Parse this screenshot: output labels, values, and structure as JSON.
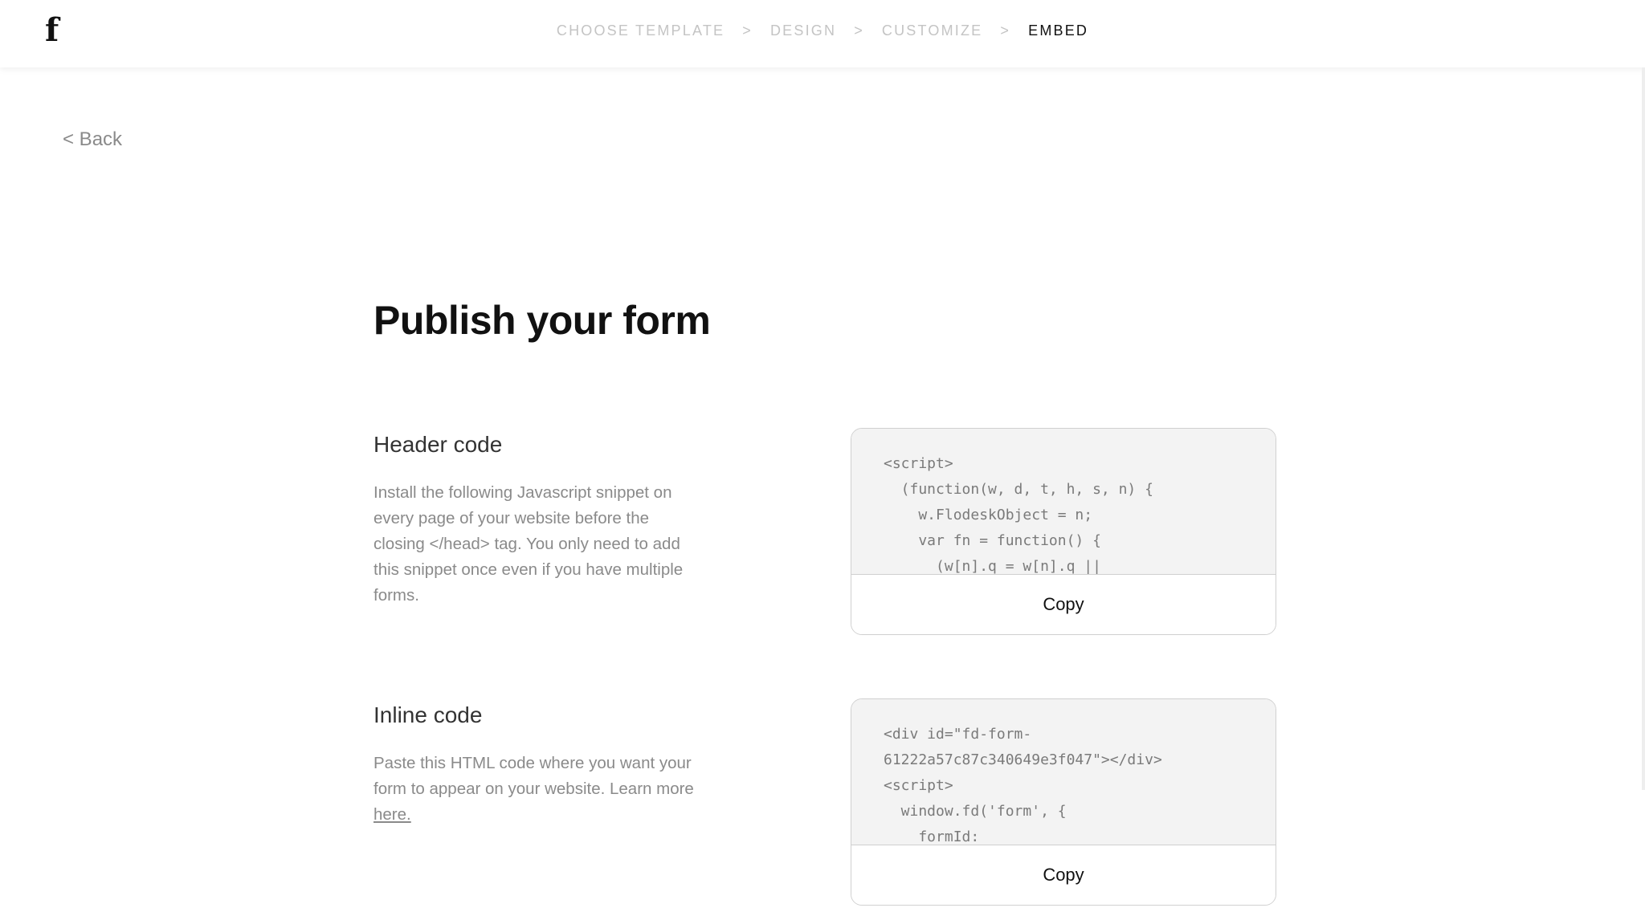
{
  "header": {
    "logo": "f",
    "steps": [
      {
        "label": "CHOOSE TEMPLATE",
        "active": false
      },
      {
        "label": "DESIGN",
        "active": false
      },
      {
        "label": "CUSTOMIZE",
        "active": false
      },
      {
        "label": "EMBED",
        "active": true
      }
    ],
    "separator": ">"
  },
  "back_label": "< Back",
  "page_title": "Publish your form",
  "sections": {
    "header_code": {
      "title": "Header code",
      "description": "Install the following Javascript snippet on every page of your website before the closing </head> tag. You only need to add this snippet once even if you have multiple forms.",
      "code": "<script>\n  (function(w, d, t, h, s, n) {\n    w.FlodeskObject = n;\n    var fn = function() {\n      (w[n].q = w[n].q ||",
      "copy_label": "Copy"
    },
    "inline_code": {
      "title": "Inline code",
      "description": "Paste this HTML code where you want your form to appear on your website. Learn more",
      "link_label": "here.",
      "code": "<div id=\"fd-form-\n61222a57c87c340649e3f047\"></div>\n<script>\n  window.fd('form', {\n    formId:",
      "copy_label": "Copy"
    }
  }
}
